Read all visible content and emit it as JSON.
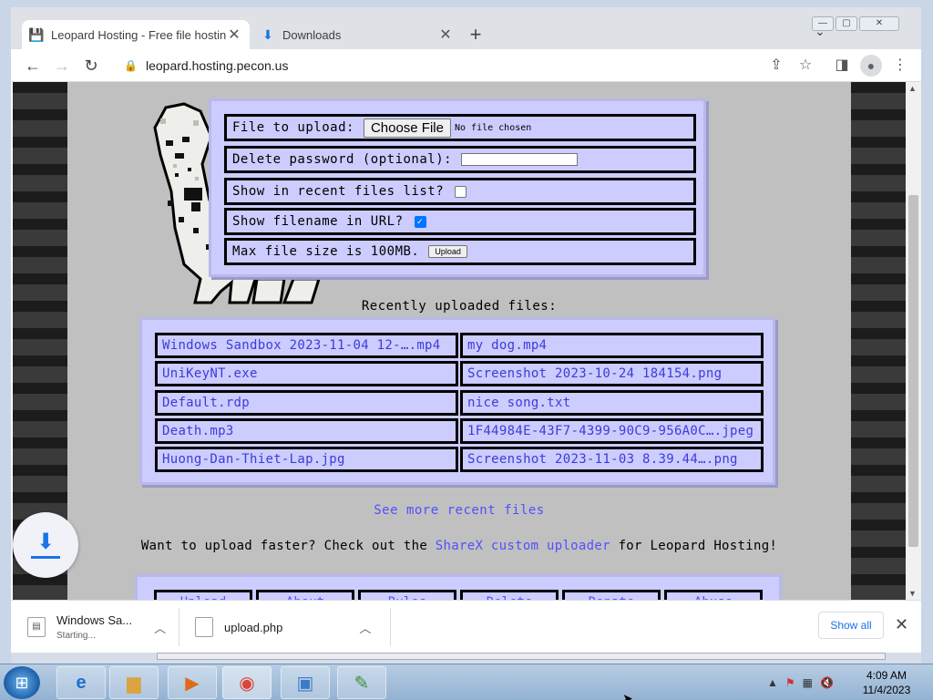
{
  "browser": {
    "tabs": [
      {
        "label": "Leopard Hosting - Free file hosting",
        "active": true,
        "icon": "floppy-icon"
      },
      {
        "label": "Downloads",
        "active": false,
        "icon": "download-icon"
      }
    ],
    "new_tab": "+",
    "url": "leopard.hosting.pecon.us"
  },
  "upload_form": {
    "file_label": "File to upload:",
    "choose_file": "Choose File",
    "no_file": "No file chosen",
    "password_label": "Delete password (optional):",
    "password_value": "",
    "recent_label": "Show in recent files list?",
    "recent_checked": false,
    "filename_label": "Show filename in URL?",
    "filename_checked": true,
    "max_size": "Max file size is 100MB.",
    "upload_button": "Upload"
  },
  "recent": {
    "title": "Recently uploaded files:",
    "files": [
      "Windows Sandbox 2023-11-04 12-….mp4",
      "my dog.mp4",
      "UniKeyNT.exe",
      "Screenshot 2023-10-24 184154.png",
      "Default.rdp",
      "nice song.txt",
      "Death.mp3",
      "1F44984E-43F7-4399-90C9-956A0C….jpeg",
      "Huong-Dan-Thiet-Lap.jpg",
      "Screenshot 2023-11-03 8.39.44….png"
    ],
    "see_more": "See more recent files"
  },
  "sharex": {
    "prefix": "Want to upload faster? Check out the",
    "link": "ShareX custom uploader",
    "suffix": "for Leopard Hosting!"
  },
  "nav": [
    "Upload",
    "About",
    "Rules",
    "Delete",
    "Donate",
    "Abuse"
  ],
  "downloads": {
    "items": [
      {
        "name": "Windows Sa...",
        "status": "Starting..."
      },
      {
        "name": "upload.php",
        "status": ""
      }
    ],
    "show_all": "Show all"
  },
  "taskbar": {
    "time": "4:09 AM",
    "date": "11/4/2023"
  }
}
